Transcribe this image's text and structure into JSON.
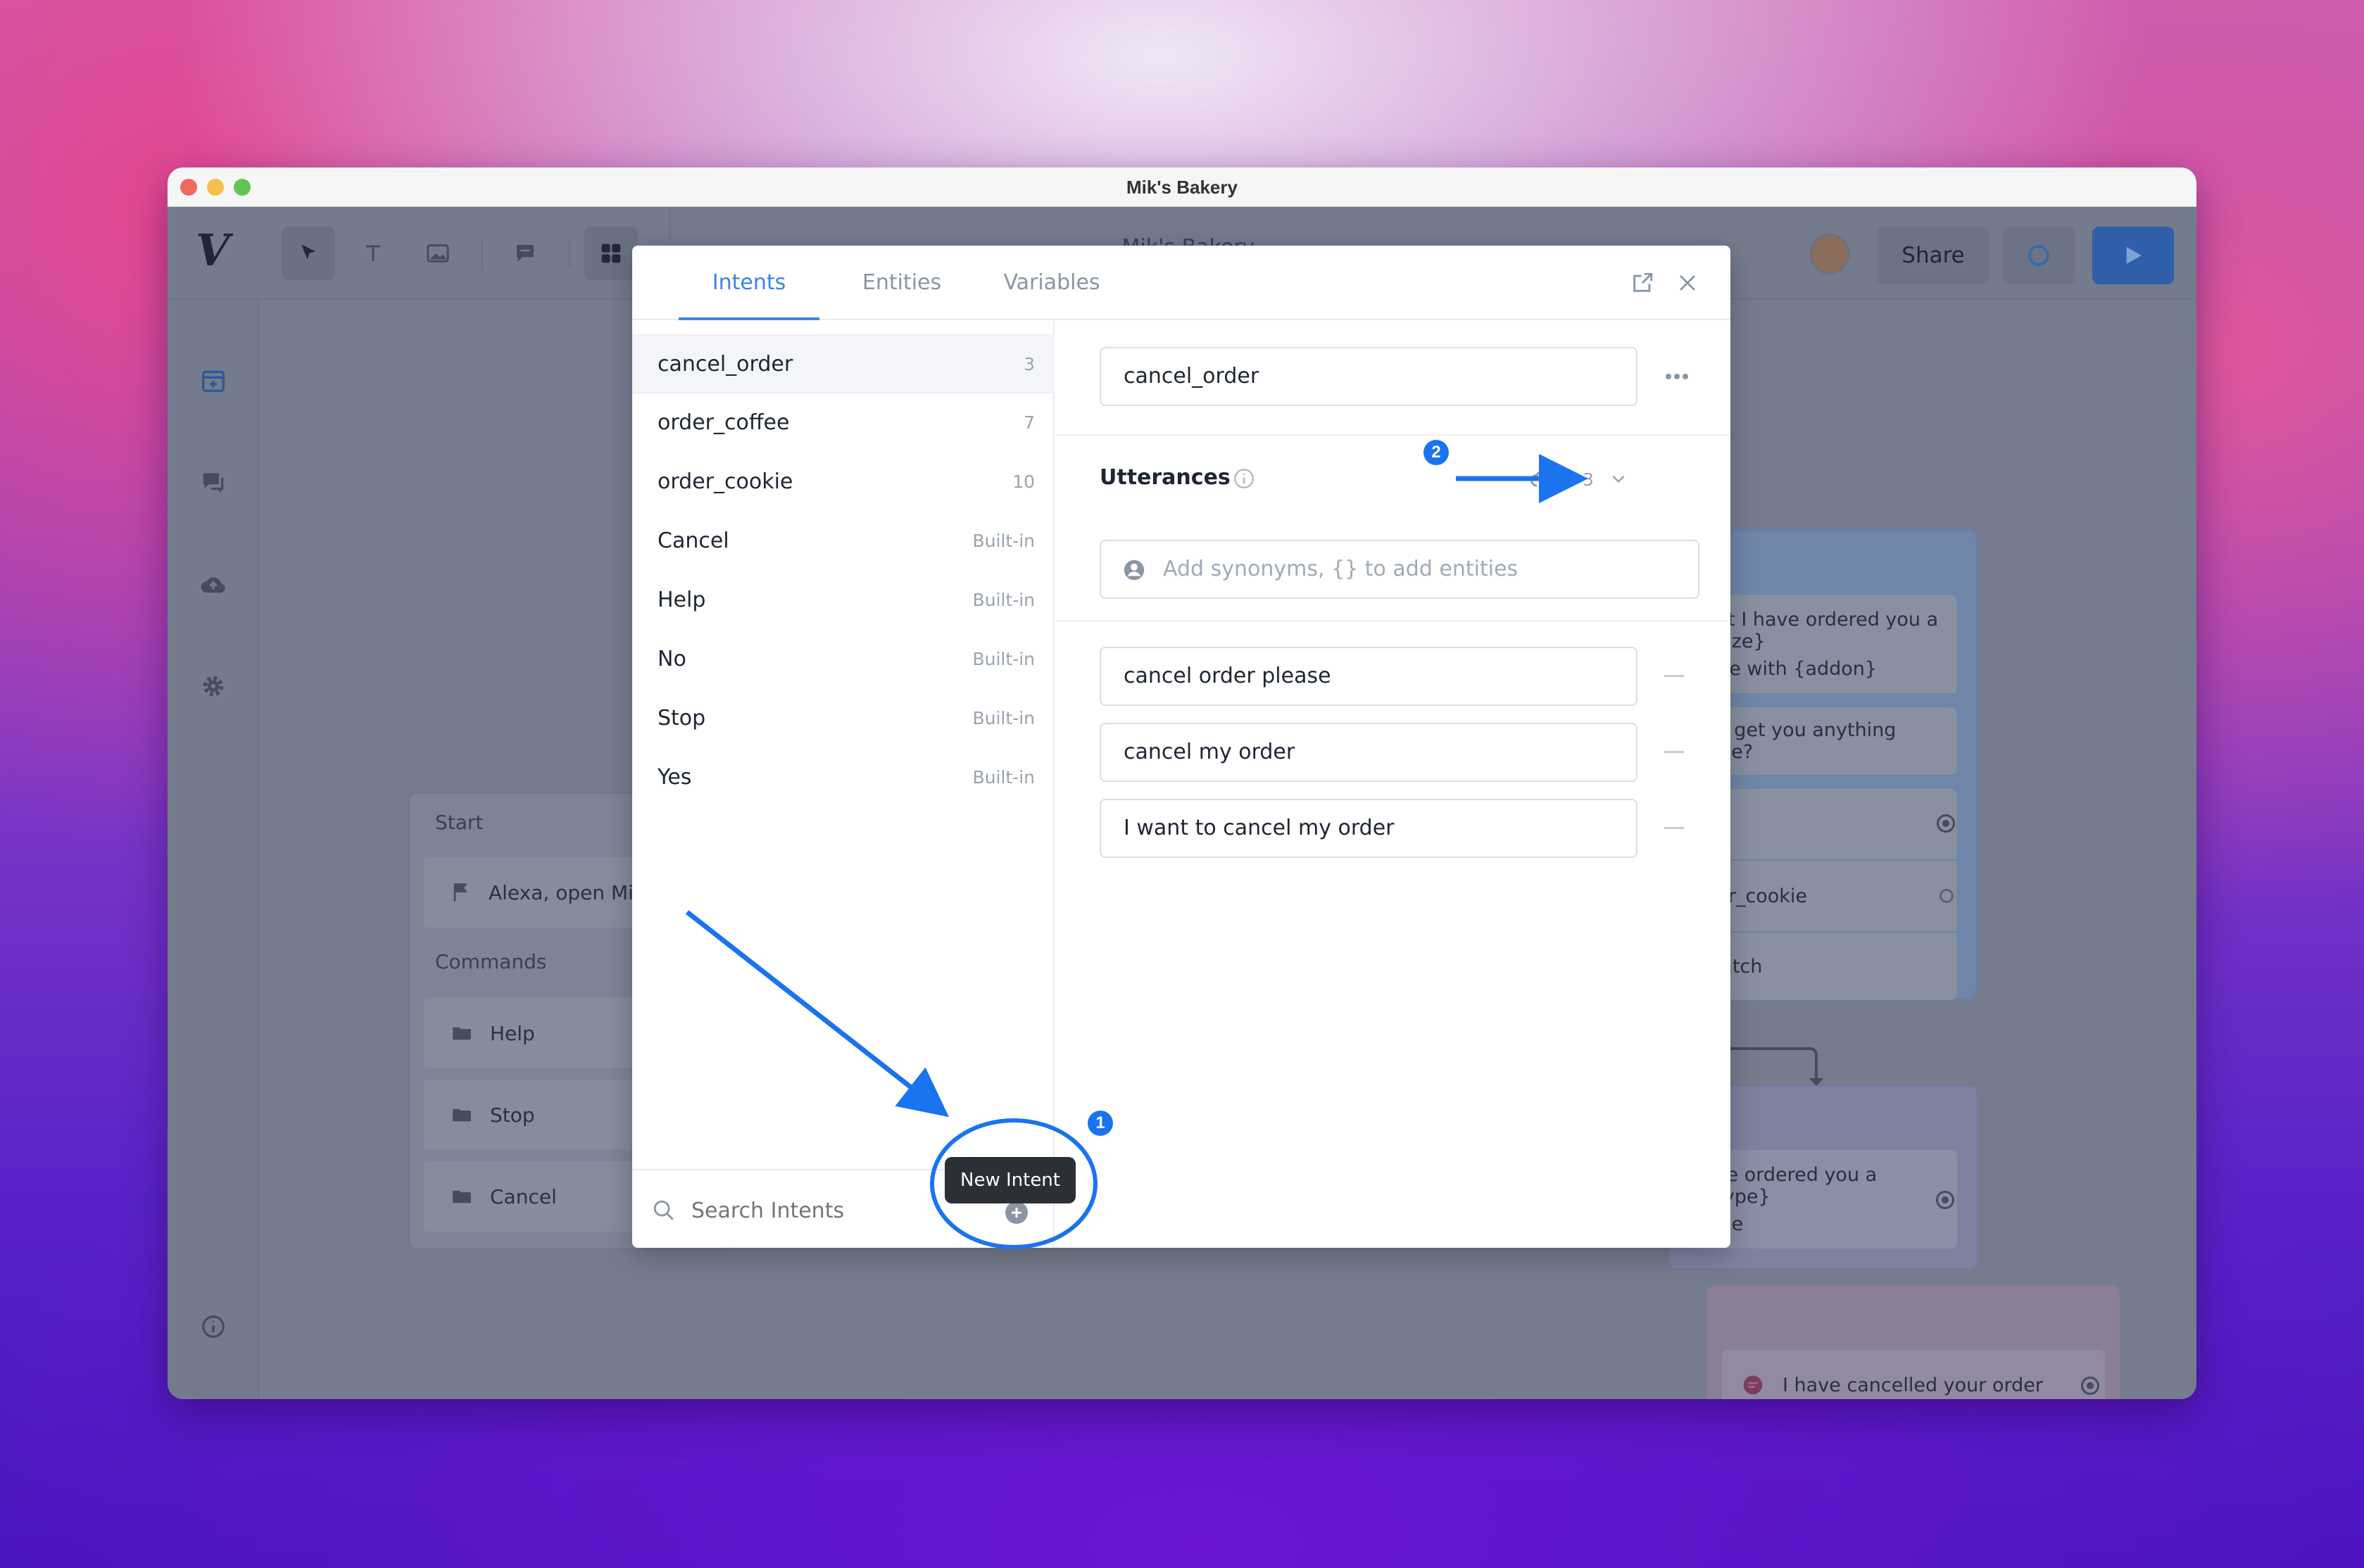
{
  "window": {
    "title": "Mik's Bakery",
    "traffic_colors": [
      "#ed6a5e",
      "#f5bf4f",
      "#62c554"
    ]
  },
  "header": {
    "logo": "V",
    "project_title": "Mik's Bakery",
    "share_label": "Share",
    "tools": [
      "select-icon",
      "text-icon",
      "image-icon",
      "comment-icon",
      "grid-icon"
    ]
  },
  "sidebar": {
    "icons": [
      "calendar-plus-icon",
      "chat-icon",
      "cloud-upload-icon",
      "gear-icon",
      "info-icon"
    ]
  },
  "canvas": {
    "start_card": {
      "title": "Start",
      "first_item": "Alexa, open Mi",
      "commands_label": "Commands",
      "commands": [
        "Help",
        "Stop",
        "Cancel"
      ]
    },
    "right_card_1": {
      "items": [
        "eat I have ordered you a {size}",
        "ffee with {addon}",
        "n I get you anything else?",
        "der_cookie",
        "Match"
      ]
    },
    "right_card_2": {
      "items": [
        "ave ordered you a {type}",
        "okie"
      ]
    },
    "right_card_3": {
      "item": "I have cancelled your order"
    }
  },
  "modal": {
    "tabs": [
      "Intents",
      "Entities",
      "Variables"
    ],
    "active_tab": "Intents",
    "intents": [
      {
        "name": "cancel_order",
        "count": "3",
        "selected": true
      },
      {
        "name": "order_coffee",
        "count": "7"
      },
      {
        "name": "order_cookie",
        "count": "10"
      },
      {
        "name": "Cancel",
        "count": "Built-in"
      },
      {
        "name": "Help",
        "count": "Built-in"
      },
      {
        "name": "No",
        "count": "Built-in"
      },
      {
        "name": "Stop",
        "count": "Built-in"
      },
      {
        "name": "Yes",
        "count": "Built-in"
      }
    ],
    "search_placeholder": "Search Intents",
    "tooltip": "New Intent",
    "detail": {
      "intent_name": "cancel_order",
      "utterances_label": "Utterances",
      "utterance_count": "3",
      "add_placeholder": "Add synonyms, {} to add entities",
      "utterances": [
        "cancel order please",
        "cancel my order",
        "I want to cancel my order"
      ]
    }
  },
  "annotations": {
    "callout_1": "1",
    "callout_2": "2",
    "accent": "#1a73ef"
  }
}
